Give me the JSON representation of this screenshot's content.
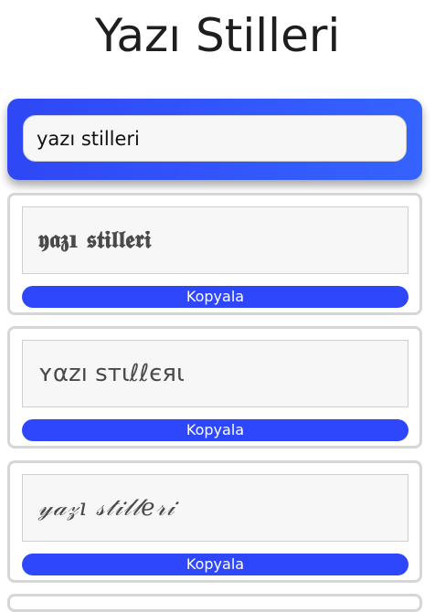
{
  "page": {
    "title": "Yazı Stilleri"
  },
  "search": {
    "value": "yazı stilleri"
  },
  "cards": [
    {
      "text": "𝖞𝖆𝖟ı 𝖘𝖙𝖎𝖑𝖑𝖊𝖗𝖎",
      "button_label": "Kopyala"
    },
    {
      "text": "ʏαzı ѕтιℓℓєяι",
      "button_label": "Kopyala"
    },
    {
      "text": "𝓎𝒶𝓏ı 𝓈𝓉𝒾𝓁𝓁𝑒𝓇𝒾",
      "button_label": "Kopyala"
    }
  ],
  "colors": {
    "accent": "#2f47fb",
    "panel_gradient_start": "#2f47f5",
    "panel_gradient_end": "#3563ff",
    "card_border": "#d6d6d6",
    "output_background": "#f7f7f7"
  }
}
